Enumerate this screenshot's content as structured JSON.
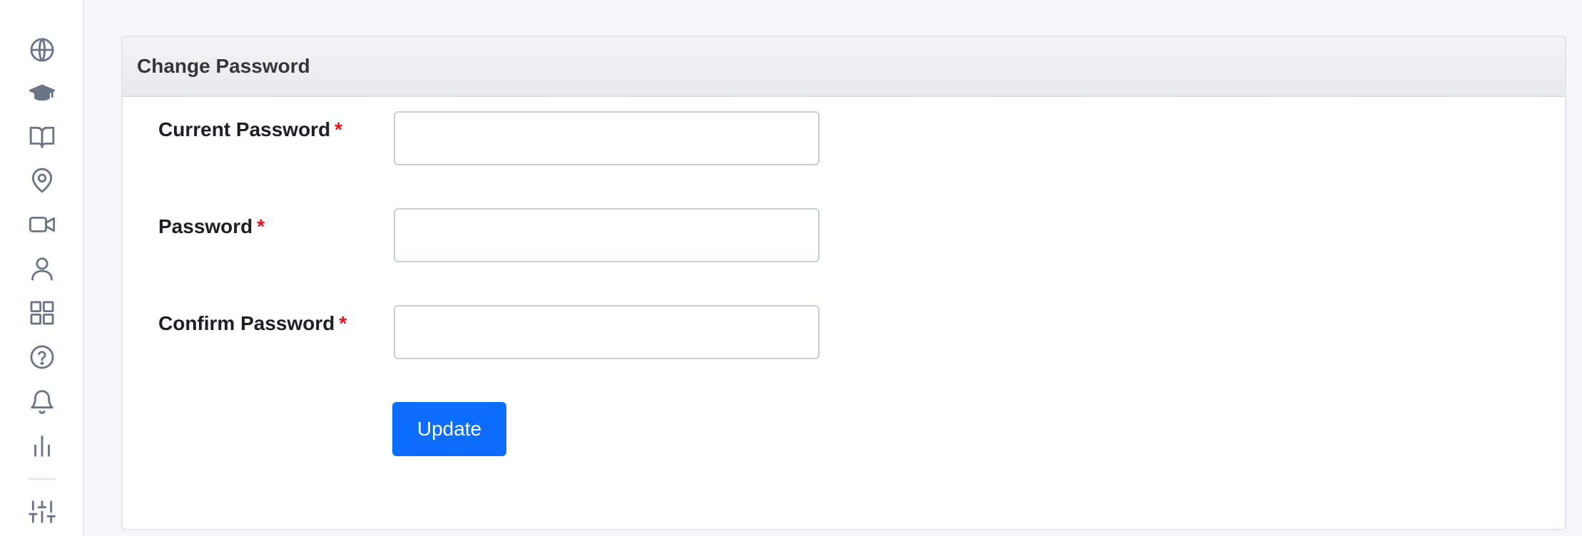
{
  "sidebar": {
    "icons": [
      {
        "name": "globe-icon"
      },
      {
        "name": "graduation-cap-icon"
      },
      {
        "name": "book-open-icon"
      },
      {
        "name": "map-pin-icon"
      },
      {
        "name": "video-icon"
      },
      {
        "name": "user-icon"
      },
      {
        "name": "grid-icon"
      },
      {
        "name": "help-circle-icon"
      },
      {
        "name": "bell-icon"
      },
      {
        "name": "bar-chart-icon"
      },
      {
        "name": "sliders-icon"
      }
    ]
  },
  "card": {
    "title": "Change Password"
  },
  "form": {
    "required_marker": "*",
    "fields": [
      {
        "label": "Current Password",
        "value": "",
        "placeholder": ""
      },
      {
        "label": "Password",
        "value": "",
        "placeholder": ""
      },
      {
        "label": "Confirm Password",
        "value": "",
        "placeholder": ""
      }
    ],
    "submit_label": "Update"
  },
  "colors": {
    "accent": "#0d6efd",
    "required": "#e0141e",
    "icon": "#6b7588"
  }
}
